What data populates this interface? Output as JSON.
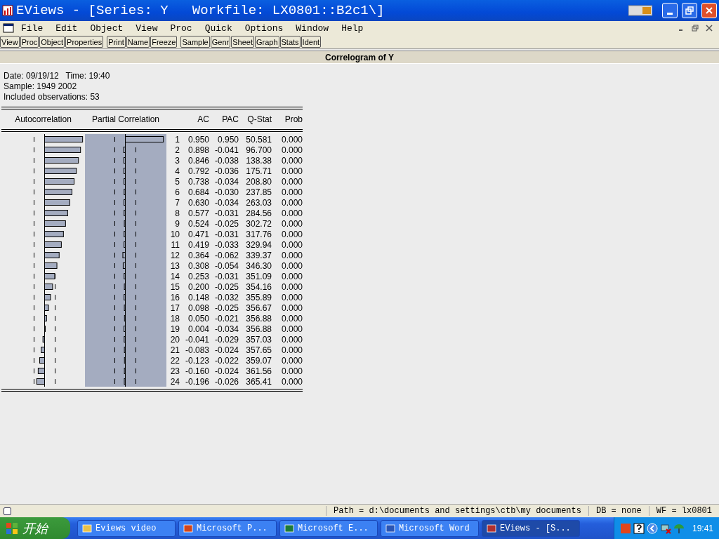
{
  "window": {
    "title": "EViews - [Series: Y   Workfile: LX0801::B2c1\\]"
  },
  "menu": [
    "File",
    "Edit",
    "Object",
    "View",
    "Proc",
    "Quick",
    "Options",
    "Window",
    "Help"
  ],
  "toolbar": [
    [
      "View",
      "Proc",
      "Object",
      "Properties"
    ],
    [
      "Print",
      "Name",
      "Freeze"
    ],
    [
      "Sample",
      "Genr",
      "Sheet",
      "Graph",
      "Stats",
      "Ident"
    ]
  ],
  "view_title": "Correlogram of Y",
  "info": [
    "Date: 09/19/12   Time: 19:40",
    "Sample: 1949 2002",
    "Included observations: 53"
  ],
  "correlogram": {
    "columns": [
      "Autocorrelation",
      "Partial Correlation",
      "AC",
      "PAC",
      "Q-Stat",
      "Prob"
    ],
    "partial_selected": true,
    "rows": [
      {
        "lag": "1",
        "ac": "0.950",
        "pac": "0.950",
        "q_stat": "50.581",
        "prob": "0.000"
      },
      {
        "lag": "2",
        "ac": "0.898",
        "pac": "-0.041",
        "q_stat": "96.700",
        "prob": "0.000"
      },
      {
        "lag": "3",
        "ac": "0.846",
        "pac": "-0.038",
        "q_stat": "138.38",
        "prob": "0.000"
      },
      {
        "lag": "4",
        "ac": "0.792",
        "pac": "-0.036",
        "q_stat": "175.71",
        "prob": "0.000"
      },
      {
        "lag": "5",
        "ac": "0.738",
        "pac": "-0.034",
        "q_stat": "208.80",
        "prob": "0.000"
      },
      {
        "lag": "6",
        "ac": "0.684",
        "pac": "-0.030",
        "q_stat": "237.85",
        "prob": "0.000"
      },
      {
        "lag": "7",
        "ac": "0.630",
        "pac": "-0.034",
        "q_stat": "263.03",
        "prob": "0.000"
      },
      {
        "lag": "8",
        "ac": "0.577",
        "pac": "-0.031",
        "q_stat": "284.56",
        "prob": "0.000"
      },
      {
        "lag": "9",
        "ac": "0.524",
        "pac": "-0.025",
        "q_stat": "302.72",
        "prob": "0.000"
      },
      {
        "lag": "10",
        "ac": "0.471",
        "pac": "-0.031",
        "q_stat": "317.76",
        "prob": "0.000"
      },
      {
        "lag": "11",
        "ac": "0.419",
        "pac": "-0.033",
        "q_stat": "329.94",
        "prob": "0.000"
      },
      {
        "lag": "12",
        "ac": "0.364",
        "pac": "-0.062",
        "q_stat": "339.37",
        "prob": "0.000"
      },
      {
        "lag": "13",
        "ac": "0.308",
        "pac": "-0.054",
        "q_stat": "346.30",
        "prob": "0.000"
      },
      {
        "lag": "14",
        "ac": "0.253",
        "pac": "-0.031",
        "q_stat": "351.09",
        "prob": "0.000"
      },
      {
        "lag": "15",
        "ac": "0.200",
        "pac": "-0.025",
        "q_stat": "354.16",
        "prob": "0.000"
      },
      {
        "lag": "16",
        "ac": "0.148",
        "pac": "-0.032",
        "q_stat": "355.89",
        "prob": "0.000"
      },
      {
        "lag": "17",
        "ac": "0.098",
        "pac": "-0.025",
        "q_stat": "356.67",
        "prob": "0.000"
      },
      {
        "lag": "18",
        "ac": "0.050",
        "pac": "-0.021",
        "q_stat": "356.88",
        "prob": "0.000"
      },
      {
        "lag": "19",
        "ac": "0.004",
        "pac": "-0.034",
        "q_stat": "356.88",
        "prob": "0.000"
      },
      {
        "lag": "20",
        "ac": "-0.041",
        "pac": "-0.029",
        "q_stat": "357.03",
        "prob": "0.000"
      },
      {
        "lag": "21",
        "ac": "-0.083",
        "pac": "-0.024",
        "q_stat": "357.65",
        "prob": "0.000"
      },
      {
        "lag": "22",
        "ac": "-0.123",
        "pac": "-0.022",
        "q_stat": "359.07",
        "prob": "0.000"
      },
      {
        "lag": "23",
        "ac": "-0.160",
        "pac": "-0.024",
        "q_stat": "361.56",
        "prob": "0.000"
      },
      {
        "lag": "24",
        "ac": "-0.196",
        "pac": "-0.026",
        "q_stat": "365.41",
        "prob": "0.000"
      }
    ]
  },
  "status_bar": {
    "checked": false,
    "path": "Path = d:\\documents and settings\\ctb\\my documents",
    "db": "DB = none",
    "wf": "WF = lx0801"
  },
  "taskbar": {
    "start": "开始",
    "tasks": [
      {
        "kind": "folder",
        "label": "Eviews video",
        "selected": false
      },
      {
        "kind": "powerpoint",
        "label": "Microsoft P...",
        "selected": false
      },
      {
        "kind": "excel",
        "label": "Microsoft E...",
        "selected": false
      },
      {
        "kind": "word",
        "label": "Microsoft Word",
        "selected": false
      },
      {
        "kind": "eviews",
        "label": "EViews - [S...",
        "selected": true
      }
    ],
    "clock": "19:41"
  }
}
